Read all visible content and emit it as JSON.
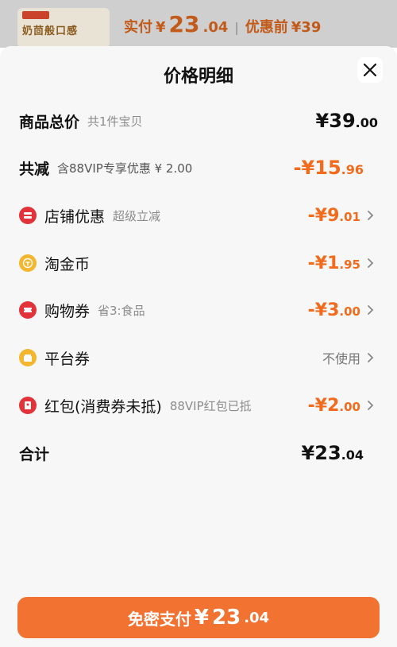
{
  "background": {
    "product_name": "奶茴般口感",
    "actual_label": "实付",
    "currency": "¥",
    "actual_int": "23",
    "actual_dec": ".04",
    "separator": "|",
    "before_label": "优惠前",
    "before_price": "¥39"
  },
  "sheet": {
    "title": "价格明细"
  },
  "rows": {
    "total": {
      "label": "商品总价",
      "sub": "共1件宝贝",
      "currency": "¥",
      "int": "39",
      "dec": ".00"
    },
    "reduce": {
      "label": "共减",
      "sub": "含88VIP专享优惠 ¥ 2.00",
      "sign": "-¥",
      "int": "15",
      "dec": ".96"
    },
    "store": {
      "icon": "store-coupon-icon",
      "label": "店铺优惠",
      "sub": "超级立减",
      "sign": "-¥",
      "int": "9",
      "dec": ".01"
    },
    "coin": {
      "icon": "taojinbi-coin-icon",
      "label": "淘金币",
      "sub": "",
      "sign": "-¥",
      "int": "1",
      "dec": ".95"
    },
    "voucher": {
      "icon": "shopping-voucher-icon",
      "label": "购物券",
      "sub": "省3:食品",
      "sign": "-¥",
      "int": "3",
      "dec": ".00"
    },
    "platform": {
      "icon": "platform-coupon-icon",
      "label": "平台券",
      "value": "不使用"
    },
    "redpacket": {
      "icon": "red-packet-icon",
      "label": "红包(消费券未抵)",
      "sub": "88VIP红包已抵",
      "sign": "-¥",
      "int": "2",
      "dec": ".00"
    },
    "sum": {
      "label": "合计",
      "currency": "¥",
      "int": "23",
      "dec": ".04"
    }
  },
  "pay_button": {
    "label": "免密支付",
    "currency": "¥",
    "int": "23",
    "dec": ".04"
  },
  "colors": {
    "accent_orange": "#f26b1d",
    "pay_button": "#f27232",
    "red_icon": "#e2323a",
    "yellow_icon": "#f3b62e"
  }
}
